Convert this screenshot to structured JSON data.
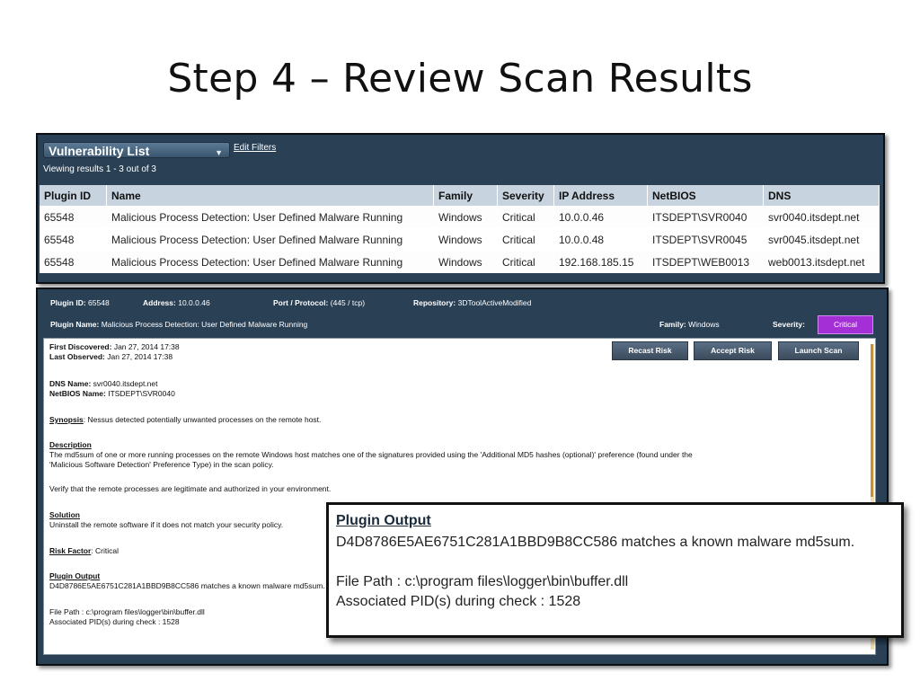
{
  "slide": {
    "title": "Step 4 – Review Scan Results"
  },
  "vuln_list": {
    "dropdown_label": "Vulnerability List",
    "edit_filters": "Edit Filters",
    "viewing": "Viewing results 1 - 3 out of 3",
    "columns": [
      "Plugin ID",
      "Name",
      "Family",
      "Severity",
      "IP Address",
      "NetBIOS",
      "DNS"
    ],
    "rows": [
      {
        "plugin_id": "65548",
        "name": "Malicious Process Detection: User Defined Malware Running",
        "family": "Windows",
        "severity": "Critical",
        "ip": "10.0.0.46",
        "netbios": "ITSDEPT\\SVR0040",
        "dns": "svr0040.itsdept.net"
      },
      {
        "plugin_id": "65548",
        "name": "Malicious Process Detection: User Defined Malware Running",
        "family": "Windows",
        "severity": "Critical",
        "ip": "10.0.0.48",
        "netbios": "ITSDEPT\\SVR0045",
        "dns": "svr0045.itsdept.net"
      },
      {
        "plugin_id": "65548",
        "name": "Malicious Process Detection: User Defined Malware Running",
        "family": "Windows",
        "severity": "Critical",
        "ip": "192.168.185.15",
        "netbios": "ITSDEPT\\WEB0013",
        "dns": "web0013.itsdept.net"
      }
    ]
  },
  "detail": {
    "plugin_id_label": "Plugin ID:",
    "plugin_id": "65548",
    "address_label": "Address:",
    "address": "10.0.0.46",
    "port_label": "Port / Protocol:",
    "port": "(445 / tcp)",
    "repo_label": "Repository:",
    "repo": "3DToolActiveModified",
    "plugin_name_label": "Plugin Name:",
    "plugin_name": "Malicious Process Detection: User Defined Malware Running",
    "family_label": "Family:",
    "family": "Windows",
    "severity_label": "Severity:",
    "severity": "Critical",
    "buttons": {
      "recast": "Recast Risk",
      "accept": "Accept Risk",
      "launch": "Launch Scan"
    },
    "first_discovered_label": "First Discovered:",
    "first_discovered": "Jan 27, 2014 17:38",
    "last_observed_label": "Last Observed:",
    "last_observed": "Jan 27, 2014 17:38",
    "dns_name_label": "DNS Name:",
    "dns_name": "svr0040.itsdept.net",
    "netbios_name_label": "NetBIOS Name:",
    "netbios_name": "ITSDEPT\\SVR0040",
    "synopsis_label": "Synopsis",
    "synopsis": ": Nessus detected potentially unwanted processes on the remote host.",
    "description_label": "Description",
    "description_1": "The md5sum of one or more running processes on the remote Windows host matches one of the signatures provided using the 'Additional MD5 hashes (optional)' preference (found under the",
    "description_2": "'Malicious Software Detection' Preference Type) in the scan policy.",
    "description_3": "Verify that the remote processes are legitimate and authorized in your environment.",
    "solution_label": "Solution",
    "solution": "Uninstall the remote software if it does not match your security policy.",
    "risk_factor_label": "Risk Factor",
    "risk_factor": ": Critical",
    "plugin_output_label": "Plugin Output",
    "plugin_output_line": "D4D8786E5AE6751C281A1BBD9B8CC586 matches a known malware md5sum.",
    "file_path": "File Path : c:\\program files\\logger\\bin\\buffer.dll",
    "pids": "Associated PID(s) during check : 1528"
  },
  "callout": {
    "title": "Plugin Output",
    "line1": "D4D8786E5AE6751C281A1BBD9B8CC586 matches a known malware md5sum.",
    "line2": "File Path : c:\\program files\\logger\\bin\\buffer.dll",
    "line3": "Associated PID(s) during check : 1528"
  }
}
